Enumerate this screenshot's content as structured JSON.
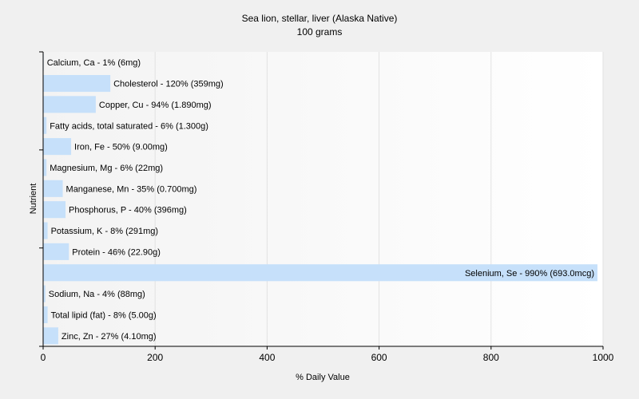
{
  "chart_data": {
    "type": "bar",
    "orientation": "horizontal",
    "title": "Sea lion, stellar, liver (Alaska Native)",
    "subtitle": "100 grams",
    "xlabel": "% Daily Value",
    "ylabel": "Nutrient",
    "xlim": [
      0,
      1000
    ],
    "xticks": [
      0,
      200,
      400,
      600,
      800,
      1000
    ],
    "grid": true,
    "legend": "none",
    "bar_color": "#c6e0fa",
    "categories": [
      "Calcium, Ca",
      "Cholesterol",
      "Copper, Cu",
      "Fatty acids, total saturated",
      "Iron, Fe",
      "Magnesium, Mg",
      "Manganese, Mn",
      "Phosphorus, P",
      "Potassium, K",
      "Protein",
      "Selenium, Se",
      "Sodium, Na",
      "Total lipid (fat)",
      "Zinc, Zn"
    ],
    "values": [
      1,
      120,
      94,
      6,
      50,
      6,
      35,
      40,
      8,
      46,
      990,
      4,
      8,
      27
    ],
    "labels": [
      "Calcium, Ca - 1% (6mg)",
      "Cholesterol - 120% (359mg)",
      "Copper, Cu - 94% (1.890mg)",
      "Fatty acids, total saturated - 6% (1.300g)",
      "Iron, Fe - 50% (9.00mg)",
      "Magnesium, Mg - 6% (22mg)",
      "Manganese, Mn - 35% (0.700mg)",
      "Phosphorus, P - 40% (396mg)",
      "Potassium, K - 8% (291mg)",
      "Protein - 46% (22.90g)",
      "Selenium, Se - 990% (693.0mcg)",
      "Sodium, Na - 4% (88mg)",
      "Total lipid (fat) - 8% (5.00g)",
      "Zinc, Zn - 27% (4.10mg)"
    ]
  }
}
